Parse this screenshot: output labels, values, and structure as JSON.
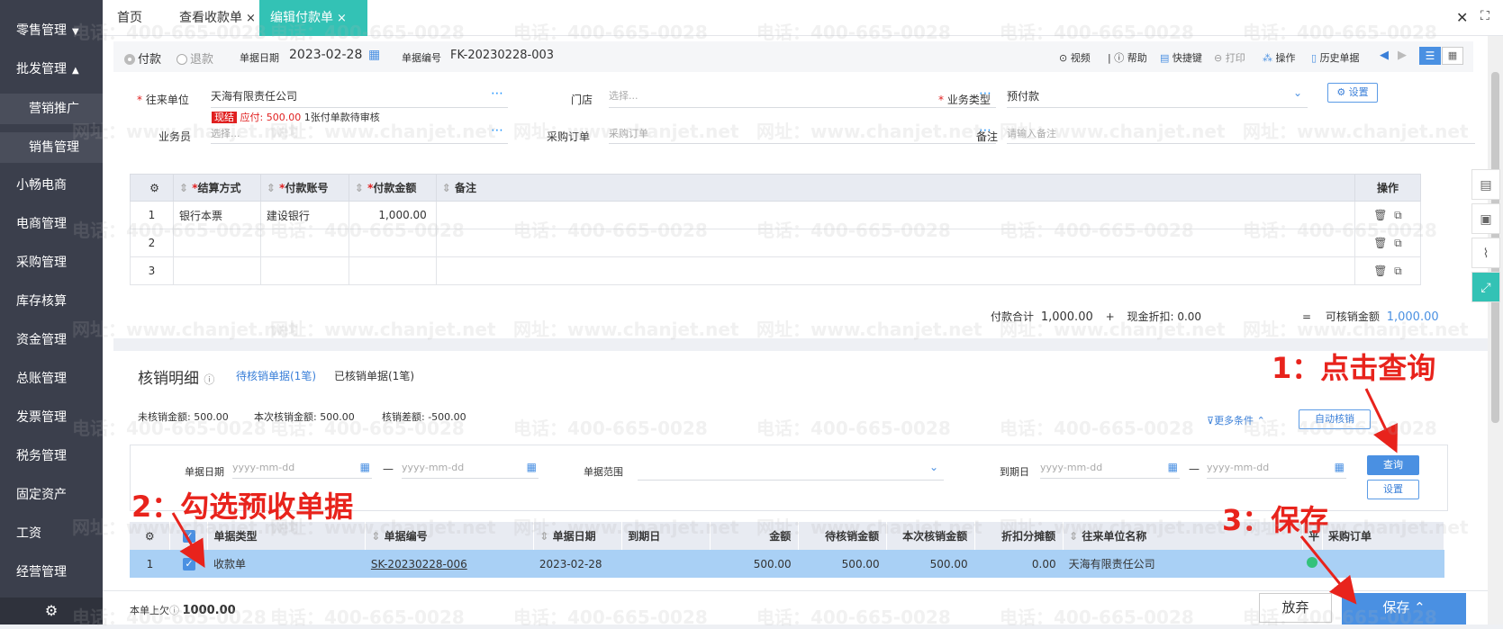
{
  "sidebar": {
    "items": [
      {
        "label": "零售管理",
        "arrow": "▼"
      },
      {
        "label": "批发管理",
        "arrow": "▲"
      },
      {
        "label": "营销推广"
      },
      {
        "label": "销售管理"
      },
      {
        "label": "小畅电商"
      },
      {
        "label": "电商管理"
      },
      {
        "label": "采购管理"
      },
      {
        "label": "库存核算"
      },
      {
        "label": "资金管理"
      },
      {
        "label": "总账管理"
      },
      {
        "label": "发票管理"
      },
      {
        "label": "税务管理"
      },
      {
        "label": "固定资产"
      },
      {
        "label": "工资"
      },
      {
        "label": "经营管理"
      }
    ],
    "gear": "⚙"
  },
  "tabs": [
    {
      "label": "首页"
    },
    {
      "label": "查看收款单",
      "close": "×"
    },
    {
      "label": "编辑付款单",
      "close": "×"
    }
  ],
  "window": {
    "close": "✕",
    "expand": "⛶"
  },
  "toolbar": {
    "radio_pay": "付款",
    "radio_refund": "退款",
    "date_label": "单据日期",
    "date_value": "2023-02-28",
    "no_label": "单据编号",
    "no_value": "FK-20230228-003",
    "actions": [
      "视频",
      "帮助",
      "快捷键",
      "打印",
      "操作",
      "历史单据"
    ]
  },
  "form": {
    "partner_label": "往来单位",
    "partner_value": "天海有限责任公司",
    "badge": "现结",
    "payable": "应付: 500.00",
    "pending_note": "1张付单款待审核",
    "store_label": "门店",
    "store_placeholder": "选择...",
    "biztype_label": "业务类型",
    "biztype_value": "预付款",
    "settings": "设置",
    "salesman_label": "业务员",
    "salesman_placeholder": "选择...",
    "po_label": "采购订单",
    "po_placeholder": "采购订单",
    "remark_label": "备注",
    "remark_placeholder": "请输入备注"
  },
  "grid1": {
    "headers": [
      "结算方式",
      "付款账号",
      "付款金额",
      "备注",
      "操作"
    ],
    "rows": [
      {
        "no": "1",
        "method": "银行本票",
        "account": "建设银行",
        "amount": "1,000.00"
      },
      {
        "no": "2",
        "method": "",
        "account": "",
        "amount": ""
      },
      {
        "no": "3",
        "method": "",
        "account": "",
        "amount": ""
      }
    ]
  },
  "totals": {
    "pay_total_label": "付款合计",
    "pay_total": "1,000.00",
    "plus": "+",
    "discount_label": "现金折扣:",
    "discount": "0.00",
    "eq": "=",
    "writeoff_label": "可核销金额",
    "writeoff": "1,000.00"
  },
  "writeoff": {
    "title": "核销明细",
    "tab_pending": "待核销单据(1笔)",
    "tab_done": "已核销单据(1笔)",
    "unwritten": "未核销金额: 500.00",
    "current": "本次核销金额: 500.00",
    "diff": "核销差额: -500.00",
    "more": "更多条件",
    "auto": "自动核销",
    "filter_date_label": "单据日期",
    "filter_range_label": "单据范围",
    "filter_due_label": "到期日",
    "date_placeholder": "yyyy-mm-dd",
    "dash": "—",
    "query": "查询",
    "setting": "设置"
  },
  "grid2": {
    "headers": [
      "单据类型",
      "单据编号",
      "单据日期",
      "到期日",
      "金额",
      "待核销金额",
      "本次核销金额",
      "折扣分摊额",
      "往来单位名称",
      "平",
      "采购订单"
    ],
    "rows": [
      {
        "no": "1",
        "type": "收款单",
        "code": "SK-20230228-006",
        "date": "2023-02-28",
        "due": "",
        "amount": "500.00",
        "pending": "500.00",
        "current": "500.00",
        "discount": "0.00",
        "partner": "天海有限责任公司"
      }
    ]
  },
  "footer": {
    "prev_debt_label": "本单上欠",
    "prev_debt": "1000.00",
    "discard": "放弃",
    "save": "保存"
  },
  "annotations": {
    "step1": "1：点击查询",
    "step2": "2：勾选预收单据",
    "step3": "3：保存"
  },
  "watermark": {
    "phone": "电话：400-665-0028",
    "site": "网址：www.chanjet.net"
  }
}
